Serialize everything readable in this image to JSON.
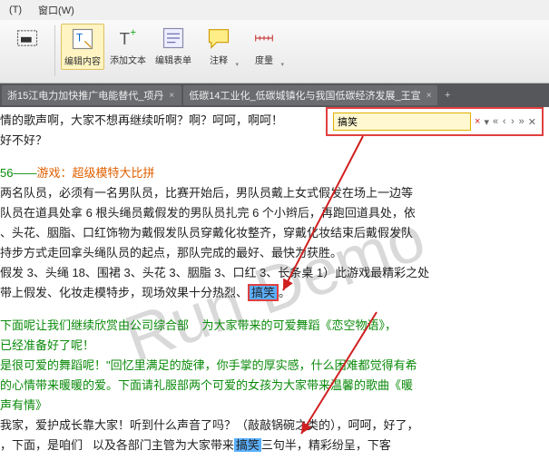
{
  "menu": {
    "tools": "(T)",
    "window": "窗口(W)"
  },
  "toolbar": {
    "edit_content": "编辑内容",
    "add_text": "添加文本",
    "edit_form": "编辑表单",
    "annotate": "注释",
    "measure": "度量"
  },
  "tabs": {
    "t1": "浙15江电力加快推广电能替代_项丹",
    "t2": "低碳14工业化_低碳城镇化与我国低碳经济发展_王宣",
    "close": "×",
    "add": "+"
  },
  "search": {
    "value": "搞笑",
    "clear": "×",
    "dd": "▾",
    "prev": "‹",
    "next": "›",
    "prev2": "«",
    "next2": "»",
    "close": "✕"
  },
  "watermark": "Run Demo",
  "text": {
    "p1": "情的歌声啊，大家不想再继续听啊？啊？呵呵，啊呵！",
    "p2": "好不好？",
    "sec_num": "56——",
    "sec_title": "游戏：超级模特大比拼",
    "p3": "两名队员，必须有一名男队员，比赛开始后，男队员戴上女式假发在场上一边等",
    "p4": "队员在道具处拿 6 根头绳员戴假发的男队员扎完 6 个小辫后，再跑回道具处，依",
    "p5": "、头花、胭脂、口红饰物为戴假发队员穿戴化妆整齐，穿戴化妆结束后戴假发队",
    "p6": "持步方式走回拿头绳队员的起点，那队完成的最好、最快为获胜。",
    "p7a": "假发 3、头绳 18、围裙 3、头花 3、胭脂 3、口红 3、长条桌 1）此游戏最精彩之处",
    "p7b": "带上假发、化妆走模特步，现场效果十分热烈、",
    "p7hl": "搞笑",
    "p7c": "。",
    "p8a": "下面呢让我们继续欣赏由公司综合部",
    "p8b": "为大家带来的可爱舞蹈《恋空物语》，",
    "p9": "已经准备好了呢！",
    "p10": "是很可爱的舞蹈呢！\"回忆里满足的旋律，你手掌的厚实感，什么困难都觉得有希",
    "p11": "的心情带来暖暖的爱。下面请礼服部两个可爱的女孩为大家带来温馨的歌曲《暖",
    "p12": "声有情》",
    "p13": "我家，爱护成长靠大家！听到什么声音了吗？（敲敲锅碗之类的），呵呵，好了，",
    "p14a": "，下面，是咱们",
    "p14b": "以及各部门主管为大家带来",
    "p14hl": "搞笑",
    "p14c": "三句半，精彩纷呈，下客"
  }
}
